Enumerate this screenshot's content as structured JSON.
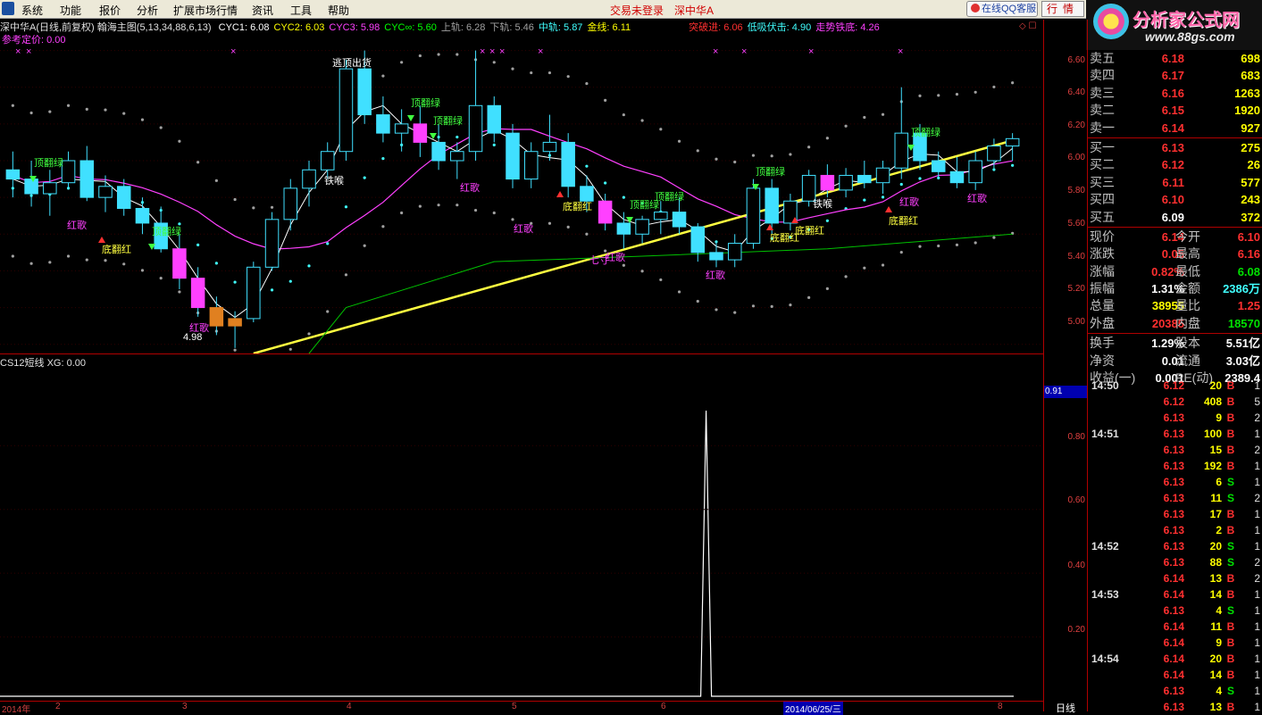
{
  "menu": {
    "items": [
      "系统",
      "功能",
      "报价",
      "分析",
      "扩展市场行情",
      "资讯",
      "工具",
      "帮助"
    ],
    "status": "交易未登录",
    "stock": "深中华A",
    "qq": "在线QQ客服",
    "hq": "行情"
  },
  "brand": {
    "name": "分析家公式网",
    "url": "www.88gs.com"
  },
  "legend": {
    "title": "深中华A(日线,前复权) 翰海主图(5,13,34,88,6,13)",
    "items": [
      {
        "label": "CYC1: 6.08",
        "color": "#ffffff"
      },
      {
        "label": "CYC2: 6.03",
        "color": "#ffff00"
      },
      {
        "label": "CYC3: 5.98",
        "color": "#ff40ff"
      },
      {
        "label": "CYC∞: 5.60",
        "color": "#00ff00"
      },
      {
        "label": "上轨: 6.28",
        "color": "#a0a0a0"
      },
      {
        "label": "下轨: 5.46",
        "color": "#a0a0a0"
      },
      {
        "label": "中轨: 5.87",
        "color": "#40ffff"
      },
      {
        "label": "金线: 6.11",
        "color": "#ffff00"
      },
      {
        "label": "突破进: 6.06",
        "color": "#ff3030"
      },
      {
        "label": "低吸伏击: 4.90",
        "color": "#40ffff"
      },
      {
        "label": "走势铁底: 4.26",
        "color": "#ff40ff"
      }
    ],
    "ref": "参考定价: 0.00"
  },
  "lowLegend": "CS12短线 XG: 0.00",
  "axisU": [
    "6.60",
    "6.40",
    "6.20",
    "6.00",
    "5.80",
    "5.60",
    "5.40",
    "5.20",
    "5.00"
  ],
  "axisL": [
    "0.80",
    "0.60",
    "0.40",
    "0.20"
  ],
  "axisBox": "0.91",
  "xaxis": {
    "labels": [
      "2014年",
      "2",
      "3",
      "4",
      "5",
      "6",
      "8"
    ],
    "date": "2014/06/25/三",
    "period": "日线"
  },
  "marks": {
    "topGreen": "顶翻绿",
    "bottomRed": "底翻红",
    "redSong": "红歌",
    "tieHou": "铁喉",
    "qiCun": "七寸",
    "escape": "逃顶出货",
    "low": "4.98"
  },
  "chart_data": {
    "type": "candlestick",
    "ylim": [
      4.95,
      6.7
    ],
    "candles": [
      [
        5.95,
        6.05,
        5.8,
        5.9
      ],
      [
        5.9,
        6.0,
        5.75,
        5.82
      ],
      [
        5.82,
        5.95,
        5.7,
        5.88
      ],
      [
        5.88,
        6.05,
        5.85,
        6.0
      ],
      [
        6.0,
        6.08,
        5.78,
        5.8
      ],
      [
        5.8,
        5.92,
        5.72,
        5.86
      ],
      [
        5.86,
        5.9,
        5.7,
        5.74
      ],
      [
        5.74,
        5.8,
        5.6,
        5.66
      ],
      [
        5.66,
        5.75,
        5.5,
        5.52
      ],
      [
        5.52,
        5.6,
        5.3,
        5.36
      ],
      [
        5.36,
        5.42,
        5.15,
        5.2
      ],
      [
        5.2,
        5.26,
        5.05,
        5.1
      ],
      [
        5.1,
        5.18,
        4.98,
        5.14
      ],
      [
        5.14,
        5.45,
        5.12,
        5.42
      ],
      [
        5.42,
        5.72,
        5.4,
        5.68
      ],
      [
        5.68,
        5.9,
        5.62,
        5.85
      ],
      [
        5.85,
        6.0,
        5.75,
        5.95
      ],
      [
        5.95,
        6.1,
        5.9,
        6.05
      ],
      [
        6.05,
        6.55,
        6.0,
        6.5
      ],
      [
        6.5,
        6.6,
        6.2,
        6.25
      ],
      [
        6.25,
        6.35,
        6.1,
        6.15
      ],
      [
        6.15,
        6.28,
        6.05,
        6.2
      ],
      [
        6.2,
        6.3,
        6.02,
        6.1
      ],
      [
        6.1,
        6.2,
        5.95,
        6.0
      ],
      [
        6.0,
        6.1,
        5.9,
        6.05
      ],
      [
        6.05,
        6.6,
        6.0,
        6.3
      ],
      [
        6.3,
        6.35,
        6.1,
        6.15
      ],
      [
        6.15,
        6.2,
        5.85,
        5.9
      ],
      [
        5.9,
        6.1,
        5.85,
        6.05
      ],
      [
        6.05,
        6.25,
        6.0,
        6.1
      ],
      [
        6.1,
        6.15,
        5.8,
        5.86
      ],
      [
        5.86,
        5.92,
        5.72,
        5.78
      ],
      [
        5.78,
        5.82,
        5.62,
        5.66
      ],
      [
        5.66,
        5.72,
        5.52,
        5.6
      ],
      [
        5.6,
        5.7,
        5.55,
        5.68
      ],
      [
        5.68,
        5.78,
        5.6,
        5.72
      ],
      [
        5.72,
        5.8,
        5.6,
        5.64
      ],
      [
        5.64,
        5.66,
        5.45,
        5.5
      ],
      [
        5.5,
        5.56,
        5.42,
        5.46
      ],
      [
        5.46,
        5.6,
        5.42,
        5.55
      ],
      [
        5.55,
        5.9,
        5.52,
        5.85
      ],
      [
        5.85,
        5.9,
        5.6,
        5.66
      ],
      [
        5.66,
        5.82,
        5.62,
        5.78
      ],
      [
        5.78,
        5.95,
        5.75,
        5.92
      ],
      [
        5.92,
        5.98,
        5.8,
        5.84
      ],
      [
        5.84,
        5.96,
        5.8,
        5.92
      ],
      [
        5.92,
        6.0,
        5.85,
        5.88
      ],
      [
        5.88,
        6.0,
        5.82,
        5.96
      ],
      [
        5.96,
        6.4,
        5.9,
        6.15
      ],
      [
        6.15,
        6.2,
        5.95,
        6.0
      ],
      [
        6.0,
        6.05,
        5.9,
        5.94
      ],
      [
        5.94,
        6.02,
        5.85,
        5.88
      ],
      [
        5.88,
        6.05,
        5.84,
        6.0
      ],
      [
        6.0,
        6.12,
        5.96,
        6.08
      ],
      [
        6.08,
        6.15,
        6.0,
        6.12
      ]
    ],
    "xg": {
      "spike_index": 0.69,
      "peak": 0.91
    }
  },
  "quote": {
    "asks": [
      [
        "卖五",
        "6.18",
        "698"
      ],
      [
        "卖四",
        "6.17",
        "683"
      ],
      [
        "卖三",
        "6.16",
        "1263"
      ],
      [
        "卖二",
        "6.15",
        "1920"
      ],
      [
        "卖一",
        "6.14",
        "927"
      ]
    ],
    "bids": [
      [
        "买一",
        "6.13",
        "275"
      ],
      [
        "买二",
        "6.12",
        "26"
      ],
      [
        "买三",
        "6.11",
        "577"
      ],
      [
        "买四",
        "6.10",
        "243"
      ],
      [
        "买五",
        "6.09",
        "372"
      ]
    ],
    "stats": [
      [
        "现价",
        "6.14",
        "red",
        "今开",
        "6.10",
        "red"
      ],
      [
        "涨跌",
        "0.05",
        "red",
        "最高",
        "6.16",
        "red"
      ],
      [
        "涨幅",
        "0.82%",
        "red",
        "最低",
        "6.08",
        "green"
      ],
      [
        "振幅",
        "1.31%",
        "white",
        "金额",
        "2386万",
        "cyan"
      ],
      [
        "总量",
        "38955",
        "yellow",
        "量比",
        "1.25",
        "red"
      ],
      [
        "外盘",
        "20385",
        "red",
        "内盘",
        "18570",
        "green"
      ],
      [
        "换手",
        "1.29%",
        "white",
        "股本",
        "5.51亿",
        "white"
      ],
      [
        "净资",
        "0.01",
        "white",
        "流通",
        "3.03亿",
        "white"
      ],
      [
        "收益(一)",
        "0.001",
        "white",
        "PE(动)",
        "2389.4",
        "white"
      ]
    ]
  },
  "trades": [
    [
      "14:50",
      "6.12",
      "20",
      "B",
      "1"
    ],
    [
      "",
      "6.12",
      "408",
      "B",
      "5"
    ],
    [
      "",
      "6.13",
      "9",
      "B",
      "2"
    ],
    [
      "14:51",
      "6.13",
      "100",
      "B",
      "1"
    ],
    [
      "",
      "6.13",
      "15",
      "B",
      "2"
    ],
    [
      "",
      "6.13",
      "192",
      "B",
      "1"
    ],
    [
      "",
      "6.13",
      "6",
      "S",
      "1"
    ],
    [
      "",
      "6.13",
      "11",
      "S",
      "2"
    ],
    [
      "",
      "6.13",
      "17",
      "B",
      "1"
    ],
    [
      "",
      "6.13",
      "2",
      "B",
      "1"
    ],
    [
      "14:52",
      "6.13",
      "20",
      "S",
      "1"
    ],
    [
      "",
      "6.13",
      "88",
      "S",
      "2"
    ],
    [
      "",
      "6.14",
      "13",
      "B",
      "2"
    ],
    [
      "14:53",
      "6.14",
      "14",
      "B",
      "1"
    ],
    [
      "",
      "6.13",
      "4",
      "S",
      "1"
    ],
    [
      "",
      "6.14",
      "11",
      "B",
      "1"
    ],
    [
      "",
      "6.14",
      "9",
      "B",
      "1"
    ],
    [
      "14:54",
      "6.14",
      "20",
      "B",
      "1"
    ],
    [
      "",
      "6.14",
      "14",
      "B",
      "1"
    ],
    [
      "",
      "6.13",
      "4",
      "S",
      "1"
    ],
    [
      "",
      "6.13",
      "13",
      "B",
      "1"
    ]
  ]
}
